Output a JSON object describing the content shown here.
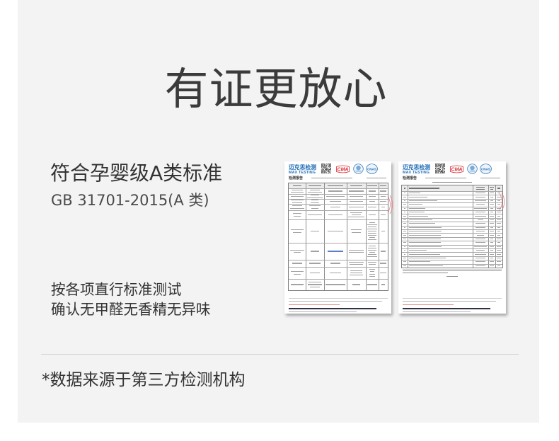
{
  "title": "有证更放心",
  "left": {
    "standard_title": "符合孕婴级A类标准",
    "standard_code": "GB 31701-2015(A 类)",
    "test_lines": [
      "按各项直行标准测试",
      "确认无甲醛无香精无异味"
    ]
  },
  "footnote": "*数据来源于第三方检测机构",
  "reports": [
    {
      "brand_cn": "迈克思检测",
      "brand_en": "MAX TESTING",
      "cma_logo": "CMA",
      "cnas_logo": "CNAS",
      "heading": "检测报告"
    },
    {
      "brand_cn": "迈克思检测",
      "brand_en": "MAX TESTING",
      "cma_logo": "CMA",
      "cnas_logo": "CNAS",
      "heading": "检测报告"
    }
  ],
  "icons": {
    "qr_code": "qr-code-icon",
    "cma": "cma-logo-icon",
    "ilac_mra": "ilac-mra-logo-icon",
    "cnas": "cnas-logo-icon",
    "seal": "seal-stamp-mark"
  },
  "colors": {
    "panel_bg": "#f3f3f3",
    "title_text": "#3b3b3b",
    "body_text": "#333333",
    "muted_text": "#4a4a4a",
    "divider": "#d3d3d3",
    "brand_blue": "#1f6db5",
    "cma_red": "#d9272e",
    "seal_pink": "#e77b86"
  }
}
